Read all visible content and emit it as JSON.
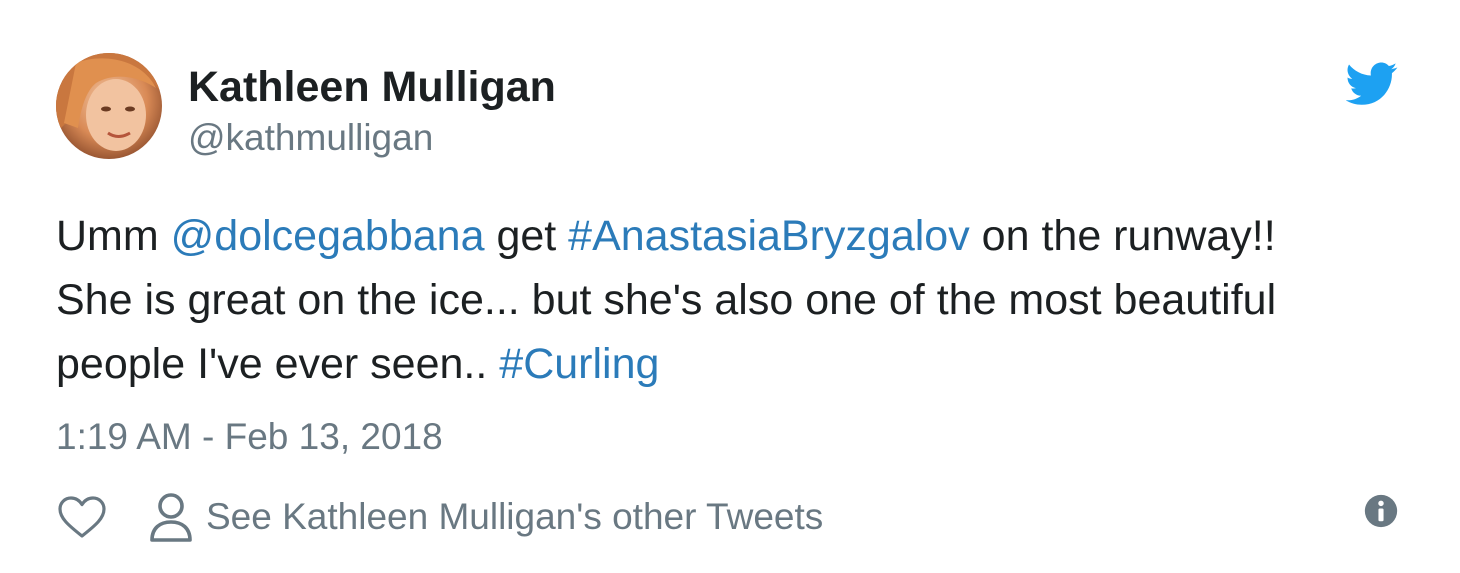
{
  "author": {
    "name": "Kathleen Mulligan",
    "handle": "@kathmulligan"
  },
  "tweet": {
    "segments": {
      "s1": "Umm ",
      "mention": "@dolcegabbana",
      "s2": " get ",
      "hashtag1": "#AnastasiaBryzgalov",
      "s3": " on the runway!!",
      "line2": "She is great on the ice... but she's also one of the most beautiful",
      "s4": "people I've ever seen.. ",
      "hashtag2": "#Curling"
    },
    "timestamp": "1:19 AM - Feb 13, 2018"
  },
  "actions": {
    "like_icon": "heart-icon",
    "profile_icon": "person-icon",
    "profile_label": "See Kathleen Mulligan's other Tweets",
    "info_icon": "info-icon"
  },
  "colors": {
    "link": "#2b7bb9",
    "text": "#1c2022",
    "muted": "#697882",
    "twitter_blue": "#1da1f2"
  }
}
